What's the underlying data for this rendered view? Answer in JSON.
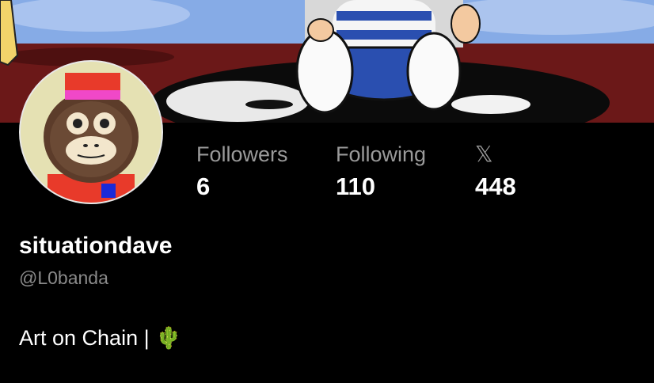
{
  "profile": {
    "display_name": "situationdave",
    "handle": "@L0banda",
    "bio_text": "Art on Chain | ",
    "bio_emoji": "🌵"
  },
  "stats": {
    "followers": {
      "label": "Followers",
      "value": "6"
    },
    "following": {
      "label": "Following",
      "value": "110"
    },
    "x": {
      "icon": "x-logo-icon",
      "glyph": "𝕏",
      "value": "448"
    }
  },
  "colors": {
    "background": "#000000",
    "muted_text": "#9a9a9a",
    "banner_sky": "#7ea6e6",
    "banner_floor": "#6b1818"
  }
}
